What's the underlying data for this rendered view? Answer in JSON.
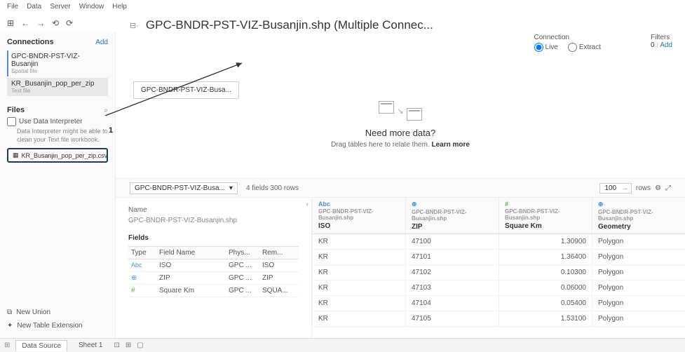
{
  "menu": [
    "File",
    "Data",
    "Server",
    "Window",
    "Help"
  ],
  "title": "GPC-BNDR-PST-VIZ-Busanjin.shp (Multiple Connec...",
  "connection": {
    "label": "Connection",
    "live": "Live",
    "extract": "Extract"
  },
  "filters": {
    "label": "Filters",
    "count": "0",
    "add": "Add"
  },
  "left": {
    "connections_label": "Connections",
    "add": "Add",
    "items": [
      {
        "name": "GPC-BNDR-PST-VIZ-Busanjin",
        "sub": "Spatial file"
      },
      {
        "name": "KR_Busanjin_pop_per_zip",
        "sub": "Text file"
      }
    ],
    "files_label": "Files",
    "use_interpreter": "Use Data Interpreter",
    "interpreter_hint": "Data Interpreter might be able to clean your Text file workbook.",
    "file_entry": "KR_Busanjin_pop_per_zip.csv",
    "annotation": "1",
    "new_union": "New Union",
    "new_ext": "New Table Extension"
  },
  "canvas": {
    "node": "GPC-BNDR-PST-VIZ-Busa...",
    "need_title": "Need more data?",
    "need_sub": "Drag tables here to relate them. ",
    "learn": "Learn more"
  },
  "midbar": {
    "dropdown": "GPC-BNDR-PST-VIZ-Busa...",
    "summary": "4 fields 300 rows",
    "rows_value": "100",
    "rows_label": "rows"
  },
  "detail": {
    "name_label": "Name",
    "name_value": "GPC-BNDR-PST-VIZ-Busanjin.shp",
    "fields_label": "Fields",
    "headers": {
      "type": "Type",
      "field": "Field Name",
      "phys": "Phys...",
      "rem": "Rem..."
    },
    "rows": [
      {
        "type": "Abc",
        "name": "ISO",
        "phys": "GPC ...",
        "rem": "ISO"
      },
      {
        "type": "globe",
        "name": "ZIP",
        "phys": "GPC ...",
        "rem": "ZIP"
      },
      {
        "type": "hash",
        "name": "Square Km",
        "phys": "GPC ...",
        "rem": "SQUA..."
      }
    ]
  },
  "grid": {
    "source": "GPC-BNDR-PST-VIZ-Busanjin.shp",
    "cols": [
      {
        "type": "Abc",
        "name": "ISO"
      },
      {
        "type": "globe",
        "name": "ZIP"
      },
      {
        "type": "hash",
        "name": "Square Km"
      },
      {
        "type": "globe",
        "name": "Geometry"
      }
    ],
    "rows": [
      {
        "iso": "KR",
        "zip": "47100",
        "sq": "1.30900",
        "geom": "Polygon"
      },
      {
        "iso": "KR",
        "zip": "47101",
        "sq": "1.36400",
        "geom": "Polygon"
      },
      {
        "iso": "KR",
        "zip": "47102",
        "sq": "0.10300",
        "geom": "Polygon"
      },
      {
        "iso": "KR",
        "zip": "47103",
        "sq": "0.06000",
        "geom": "Polygon"
      },
      {
        "iso": "KR",
        "zip": "47104",
        "sq": "0.05400",
        "geom": "Polygon"
      },
      {
        "iso": "KR",
        "zip": "47105",
        "sq": "1.53100",
        "geom": "Polygon"
      }
    ]
  },
  "tabs": {
    "datasource": "Data Source",
    "sheet": "Sheet 1"
  }
}
